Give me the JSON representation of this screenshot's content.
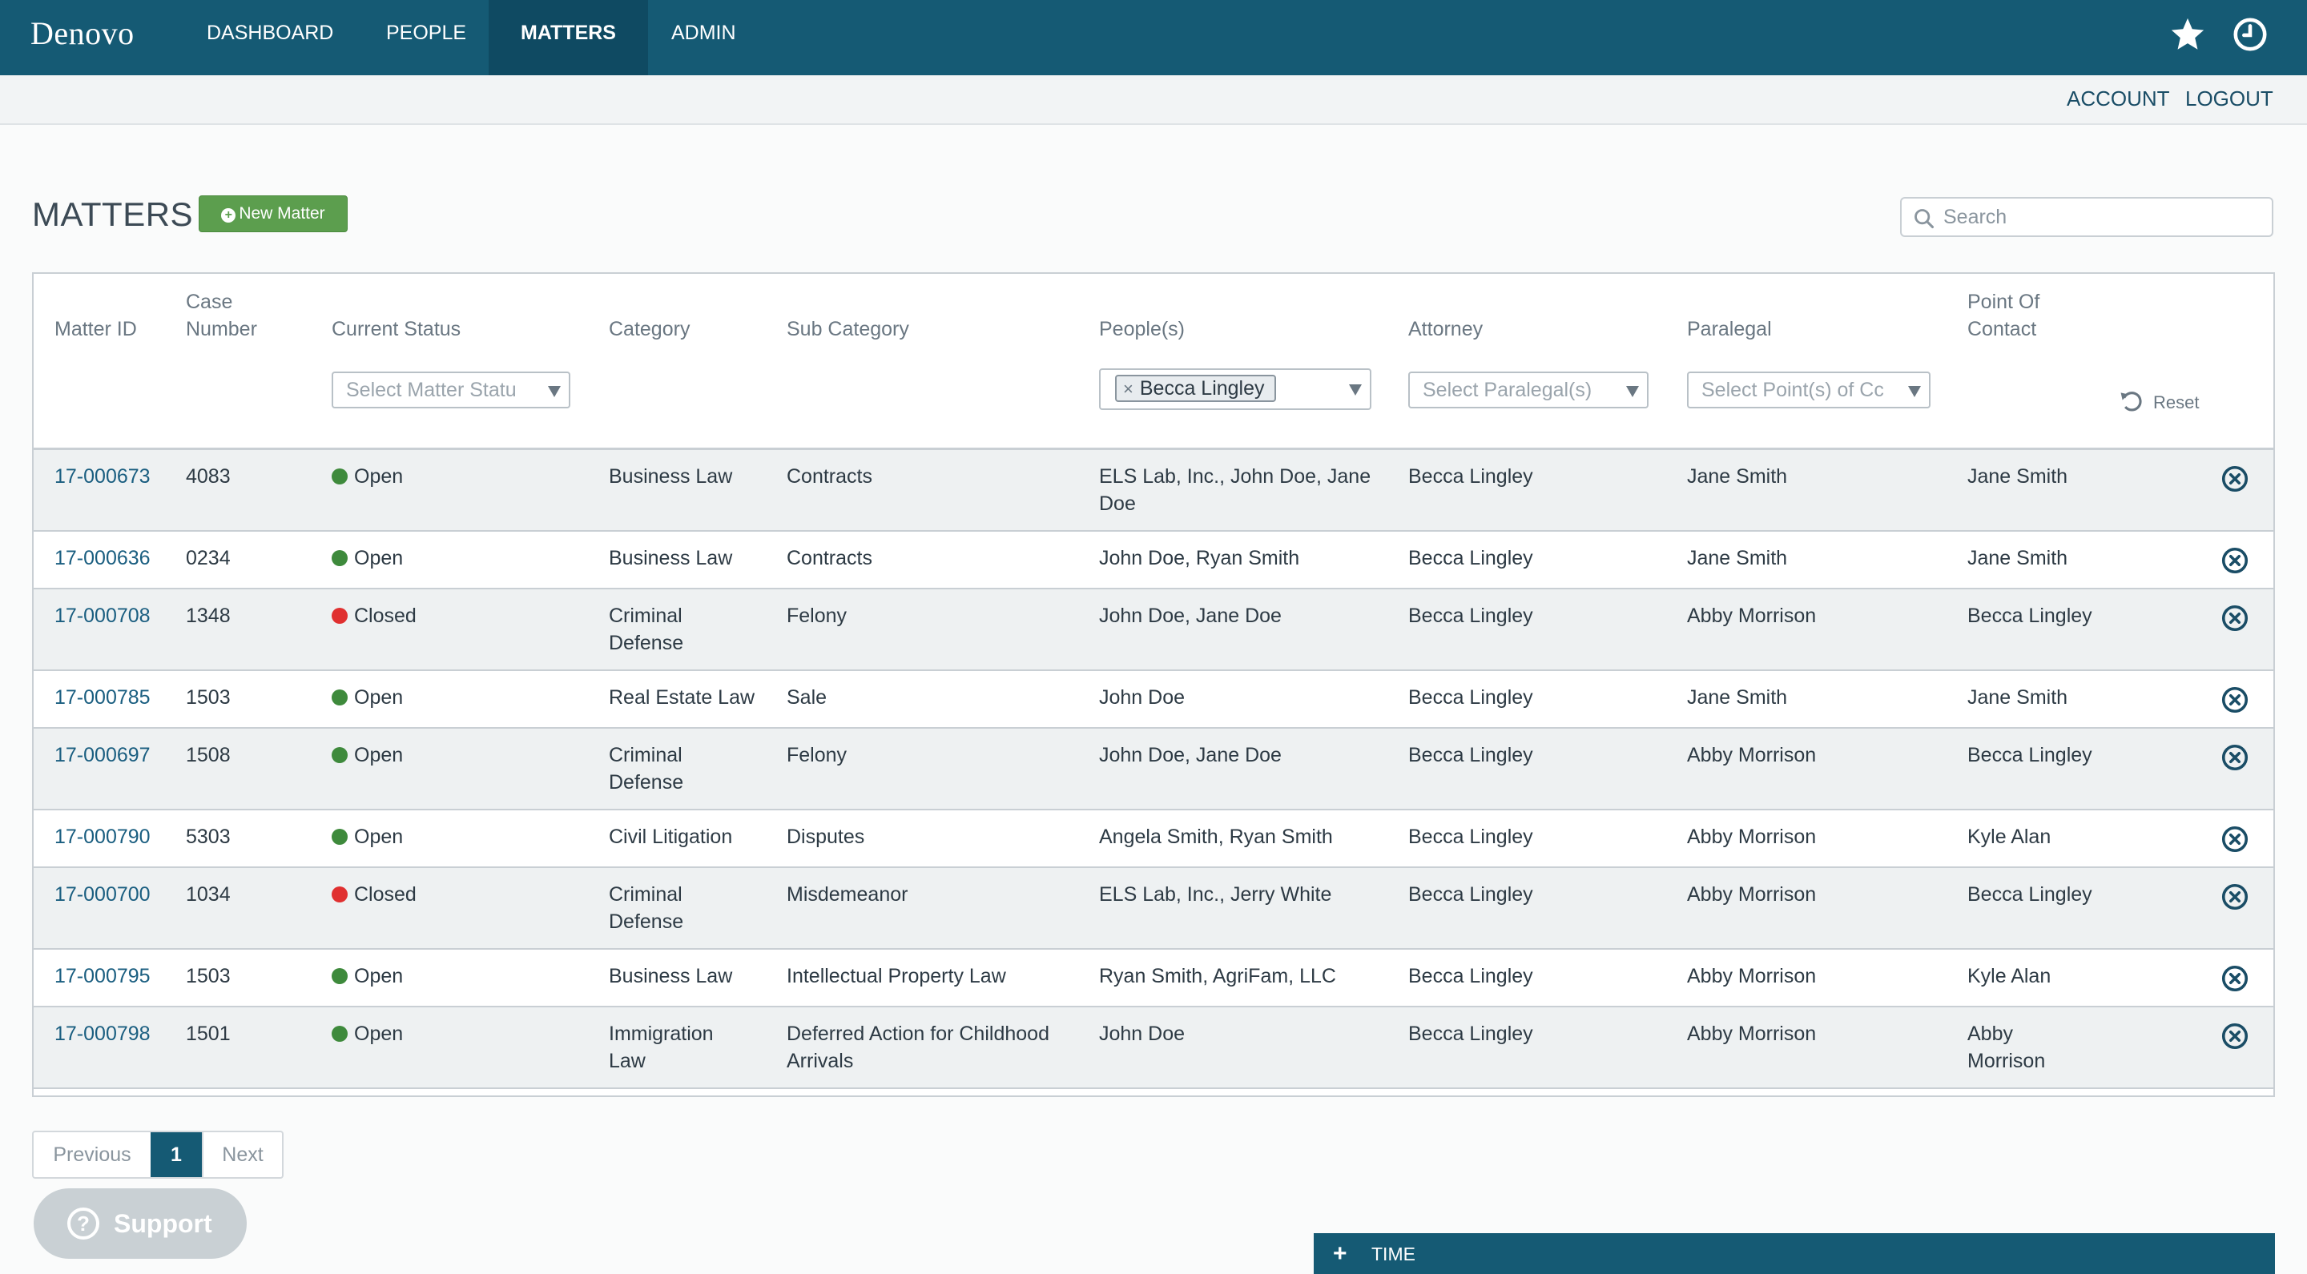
{
  "nav": {
    "brand": "Denovo",
    "items": [
      {
        "label": "DASHBOARD",
        "active": false
      },
      {
        "label": "PEOPLE",
        "active": false
      },
      {
        "label": "MATTERS",
        "active": true
      },
      {
        "label": "ADMIN",
        "active": false
      }
    ],
    "icons": [
      "star-icon",
      "clock-icon"
    ]
  },
  "subnav": {
    "account": "ACCOUNT",
    "logout": "LOGOUT"
  },
  "page": {
    "title": "MATTERS",
    "new_button": "New Matter"
  },
  "search": {
    "placeholder": "Search",
    "value": ""
  },
  "table": {
    "headers": {
      "matter_id": "Matter ID",
      "case_number_1": "Case",
      "case_number_2": "Number",
      "status": "Current Status",
      "category": "Category",
      "sub_category": "Sub Category",
      "people": "People(s)",
      "attorney": "Attorney",
      "paralegal": "Paralegal",
      "poc_1": "Point Of",
      "poc_2": "Contact"
    },
    "filters": {
      "status_placeholder": "Select Matter Statu",
      "people_tag": "Becca Lingley",
      "paralegal_placeholder": "Select Paralegal(s)",
      "poc_placeholder": "Select Point(s) of Cc",
      "reset": "Reset"
    },
    "status_colors": {
      "Open": "#3e8a3c",
      "Closed": "#e03030"
    },
    "rows": [
      {
        "matter_id": "17-000673",
        "case": "4083",
        "status": "Open",
        "category": [
          "Business Law"
        ],
        "sub": [
          "Contracts"
        ],
        "people": [
          "ELS Lab, Inc., John Doe, Jane",
          "Doe"
        ],
        "attorney": "Becca Lingley",
        "paralegal": "Jane Smith",
        "poc": [
          "Jane Smith"
        ]
      },
      {
        "matter_id": "17-000636",
        "case": "0234",
        "status": "Open",
        "category": [
          "Business Law"
        ],
        "sub": [
          "Contracts"
        ],
        "people": [
          "John Doe, Ryan Smith"
        ],
        "attorney": "Becca Lingley",
        "paralegal": "Jane Smith",
        "poc": [
          "Jane Smith"
        ]
      },
      {
        "matter_id": "17-000708",
        "case": "1348",
        "status": "Closed",
        "category": [
          "Criminal",
          "Defense"
        ],
        "sub": [
          "Felony"
        ],
        "people": [
          "John Doe, Jane Doe"
        ],
        "attorney": "Becca Lingley",
        "paralegal": "Abby Morrison",
        "poc": [
          "Becca Lingley"
        ]
      },
      {
        "matter_id": "17-000785",
        "case": "1503",
        "status": "Open",
        "category": [
          "Real Estate Law"
        ],
        "sub": [
          "Sale"
        ],
        "people": [
          "John Doe"
        ],
        "attorney": "Becca Lingley",
        "paralegal": "Jane Smith",
        "poc": [
          "Jane Smith"
        ]
      },
      {
        "matter_id": "17-000697",
        "case": "1508",
        "status": "Open",
        "category": [
          "Criminal",
          "Defense"
        ],
        "sub": [
          "Felony"
        ],
        "people": [
          "John Doe, Jane Doe"
        ],
        "attorney": "Becca Lingley",
        "paralegal": "Abby Morrison",
        "poc": [
          "Becca Lingley"
        ]
      },
      {
        "matter_id": "17-000790",
        "case": "5303",
        "status": "Open",
        "category": [
          "Civil Litigation"
        ],
        "sub": [
          "Disputes"
        ],
        "people": [
          "Angela Smith, Ryan Smith"
        ],
        "attorney": "Becca Lingley",
        "paralegal": "Abby Morrison",
        "poc": [
          "Kyle Alan"
        ]
      },
      {
        "matter_id": "17-000700",
        "case": "1034",
        "status": "Closed",
        "category": [
          "Criminal",
          "Defense"
        ],
        "sub": [
          "Misdemeanor"
        ],
        "people": [
          "ELS Lab, Inc., Jerry White"
        ],
        "attorney": "Becca Lingley",
        "paralegal": "Abby Morrison",
        "poc": [
          "Becca Lingley"
        ]
      },
      {
        "matter_id": "17-000795",
        "case": "1503",
        "status": "Open",
        "category": [
          "Business Law"
        ],
        "sub": [
          "Intellectual Property Law"
        ],
        "people": [
          "Ryan Smith, AgriFam, LLC"
        ],
        "attorney": "Becca Lingley",
        "paralegal": "Abby Morrison",
        "poc": [
          "Kyle Alan"
        ]
      },
      {
        "matter_id": "17-000798",
        "case": "1501",
        "status": "Open",
        "category": [
          "Immigration",
          "Law"
        ],
        "sub": [
          "Deferred Action for Childhood",
          "Arrivals"
        ],
        "people": [
          "John Doe"
        ],
        "attorney": "Becca Lingley",
        "paralegal": "Abby Morrison",
        "poc": [
          "Abby",
          "Morrison"
        ]
      }
    ]
  },
  "pagination": {
    "previous": "Previous",
    "current": "1",
    "next": "Next"
  },
  "support": {
    "label": "Support",
    "icon": "?"
  },
  "timebar": {
    "plus": "+",
    "label": "TIME"
  }
}
